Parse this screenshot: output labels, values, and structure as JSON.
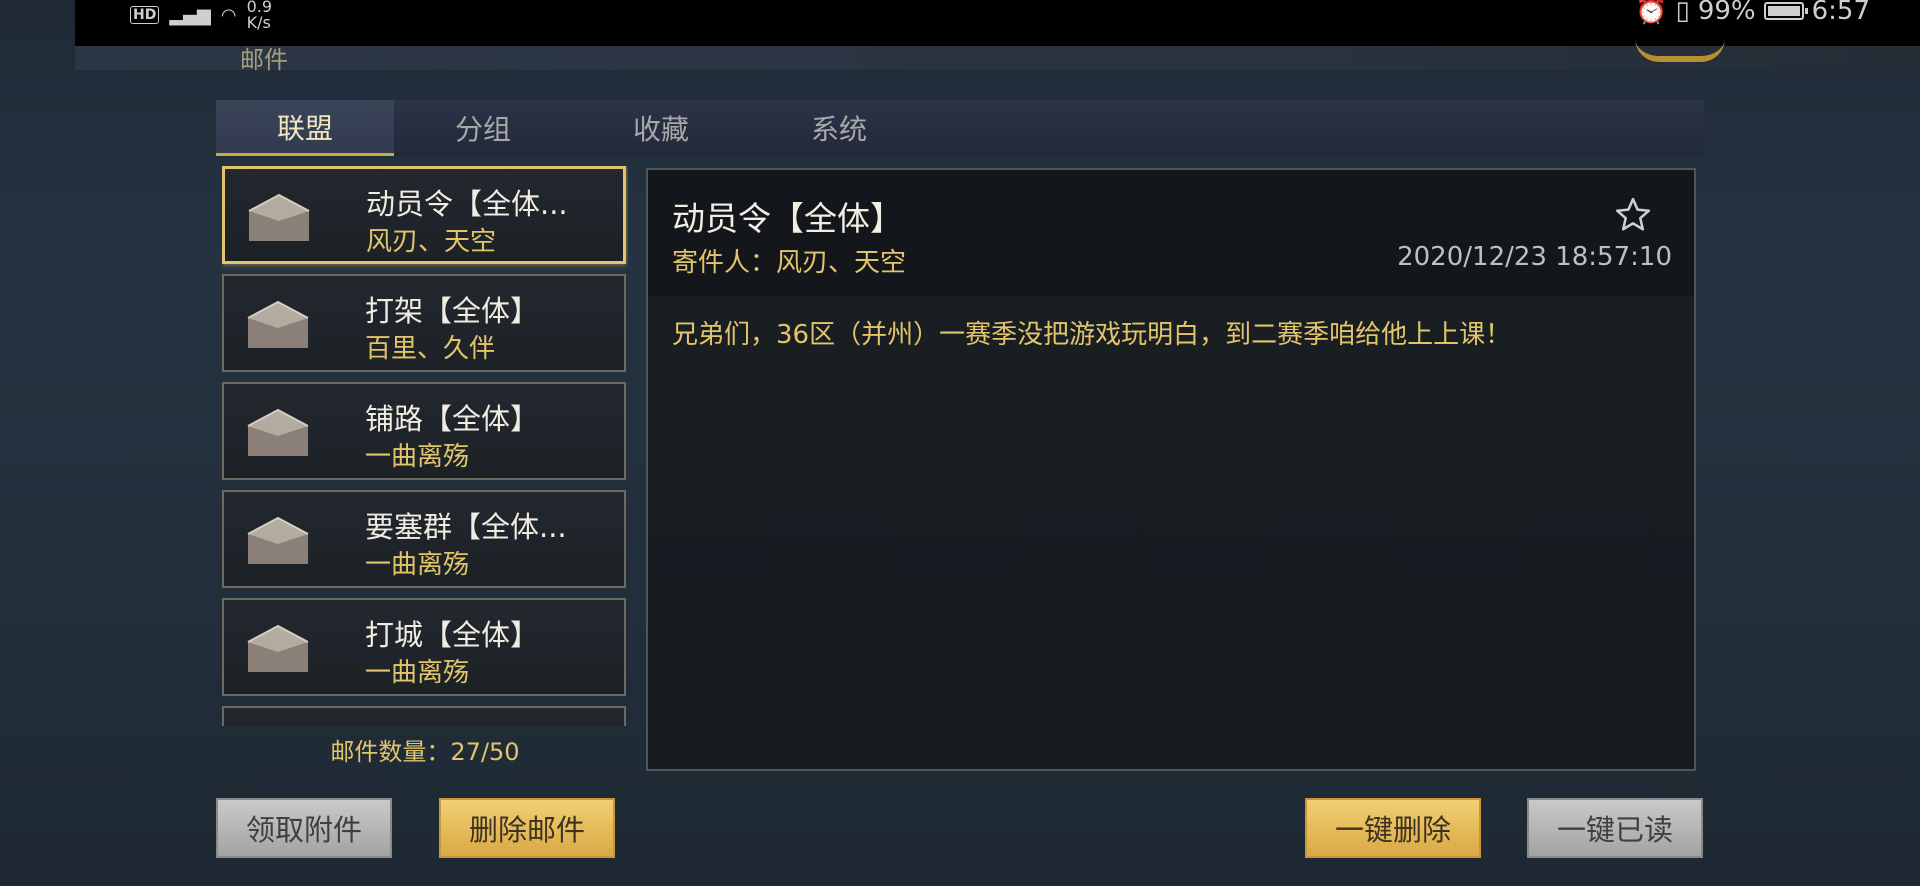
{
  "status_bar": {
    "hd": "HD",
    "network": "4G",
    "speed_value": "0.9",
    "speed_unit": "K/s",
    "battery": "99%",
    "time": "6:57"
  },
  "header": {
    "title": "邮件"
  },
  "tabs": [
    {
      "label": "联盟",
      "active": true
    },
    {
      "label": "分组",
      "active": false
    },
    {
      "label": "收藏",
      "active": false
    },
    {
      "label": "系统",
      "active": false
    }
  ],
  "mail_list": [
    {
      "title": "动员令【全体...",
      "sender": "风刃、天空",
      "selected": true
    },
    {
      "title": "打架【全体】",
      "sender": "百里、久伴",
      "selected": false
    },
    {
      "title": "铺路【全体】",
      "sender": "一曲离殇",
      "selected": false
    },
    {
      "title": "要塞群【全体...",
      "sender": "一曲离殇",
      "selected": false
    },
    {
      "title": "打城【全体】",
      "sender": "一曲离殇",
      "selected": false
    }
  ],
  "mail_count": "邮件数量：27/50",
  "detail": {
    "title": "动员令【全体】",
    "sender": "寄件人：风刃、天空",
    "date": "2020/12/23   18:57:10",
    "body": "兄弟们，36区（并州）一赛季没把游戏玩明白，到二赛季咱给他上上课！"
  },
  "buttons": {
    "claim_attachments": "领取附件",
    "delete_mail": "删除邮件",
    "delete_all": "一键删除",
    "read_all": "一键已读"
  },
  "colors": {
    "accent_gold": "#e2c46a",
    "selected_border": "#e2c46a",
    "button_gold": "#e0b24f",
    "button_gray": "#b7b7b7"
  },
  "icons": {
    "mail_item": "envelope-open-icon",
    "favorite": "star-outline-icon"
  }
}
